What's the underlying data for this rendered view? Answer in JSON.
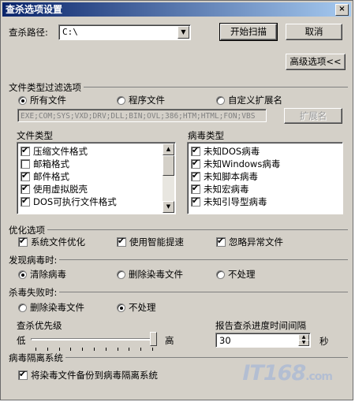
{
  "window": {
    "title": "查杀选项设置",
    "close_glyph": "×"
  },
  "scan_path": {
    "label": "查杀路径:",
    "value": "C:\\",
    "arrow": "▼"
  },
  "buttons": {
    "start_scan": "开始扫描",
    "cancel": "取消",
    "advanced": "高级选项<<",
    "extensions": "扩展名"
  },
  "file_filter": {
    "title": "文件类型过滤选项",
    "options": [
      "所有文件",
      "程序文件",
      "自定义扩展名"
    ],
    "selected": "所有文件",
    "extensions": "EXE;COM;SYS;VXD;DRV;DLL;BIN;OVL;386;HTM;HTML;FON;VBS"
  },
  "file_types": {
    "title": "文件类型",
    "items": [
      {
        "label": "压缩文件格式",
        "checked": true
      },
      {
        "label": "邮箱格式",
        "checked": false
      },
      {
        "label": "邮件格式",
        "checked": true
      },
      {
        "label": "使用虚拟脱壳",
        "checked": true
      },
      {
        "label": "DOS可执行文件格式",
        "checked": true
      }
    ]
  },
  "virus_types": {
    "title": "病毒类型",
    "items": [
      {
        "label": "未知DOS病毒",
        "checked": true
      },
      {
        "label": "未知Windows病毒",
        "checked": true
      },
      {
        "label": "未知脚本病毒",
        "checked": true
      },
      {
        "label": "未知宏病毒",
        "checked": true
      },
      {
        "label": "未知引导型病毒",
        "checked": true
      }
    ]
  },
  "optimize": {
    "title": "优化选项",
    "items": [
      {
        "label": "系统文件优化",
        "checked": true
      },
      {
        "label": "使用智能提速",
        "checked": true
      },
      {
        "label": "忽略异常文件",
        "checked": true
      }
    ]
  },
  "found_virus": {
    "title": "发现病毒时:",
    "options": [
      "清除病毒",
      "删除染毒文件",
      "不处理"
    ],
    "selected": "清除病毒"
  },
  "kill_failed": {
    "title": "杀毒失败时:",
    "options": [
      "删除染毒文件",
      "不处理"
    ],
    "selected": "不处理"
  },
  "priority": {
    "title": "查杀优先级",
    "low": "低",
    "high": "高",
    "level": 1.0
  },
  "report_interval": {
    "title": "报告查杀进度时间间隔",
    "value": "30",
    "unit": "秒"
  },
  "quarantine": {
    "title": "病毒隔离系统",
    "backup": {
      "label": "将染毒文件备份到病毒隔离系统",
      "checked": true
    }
  },
  "watermark": {
    "text": "IT168",
    "suffix": ".com"
  }
}
